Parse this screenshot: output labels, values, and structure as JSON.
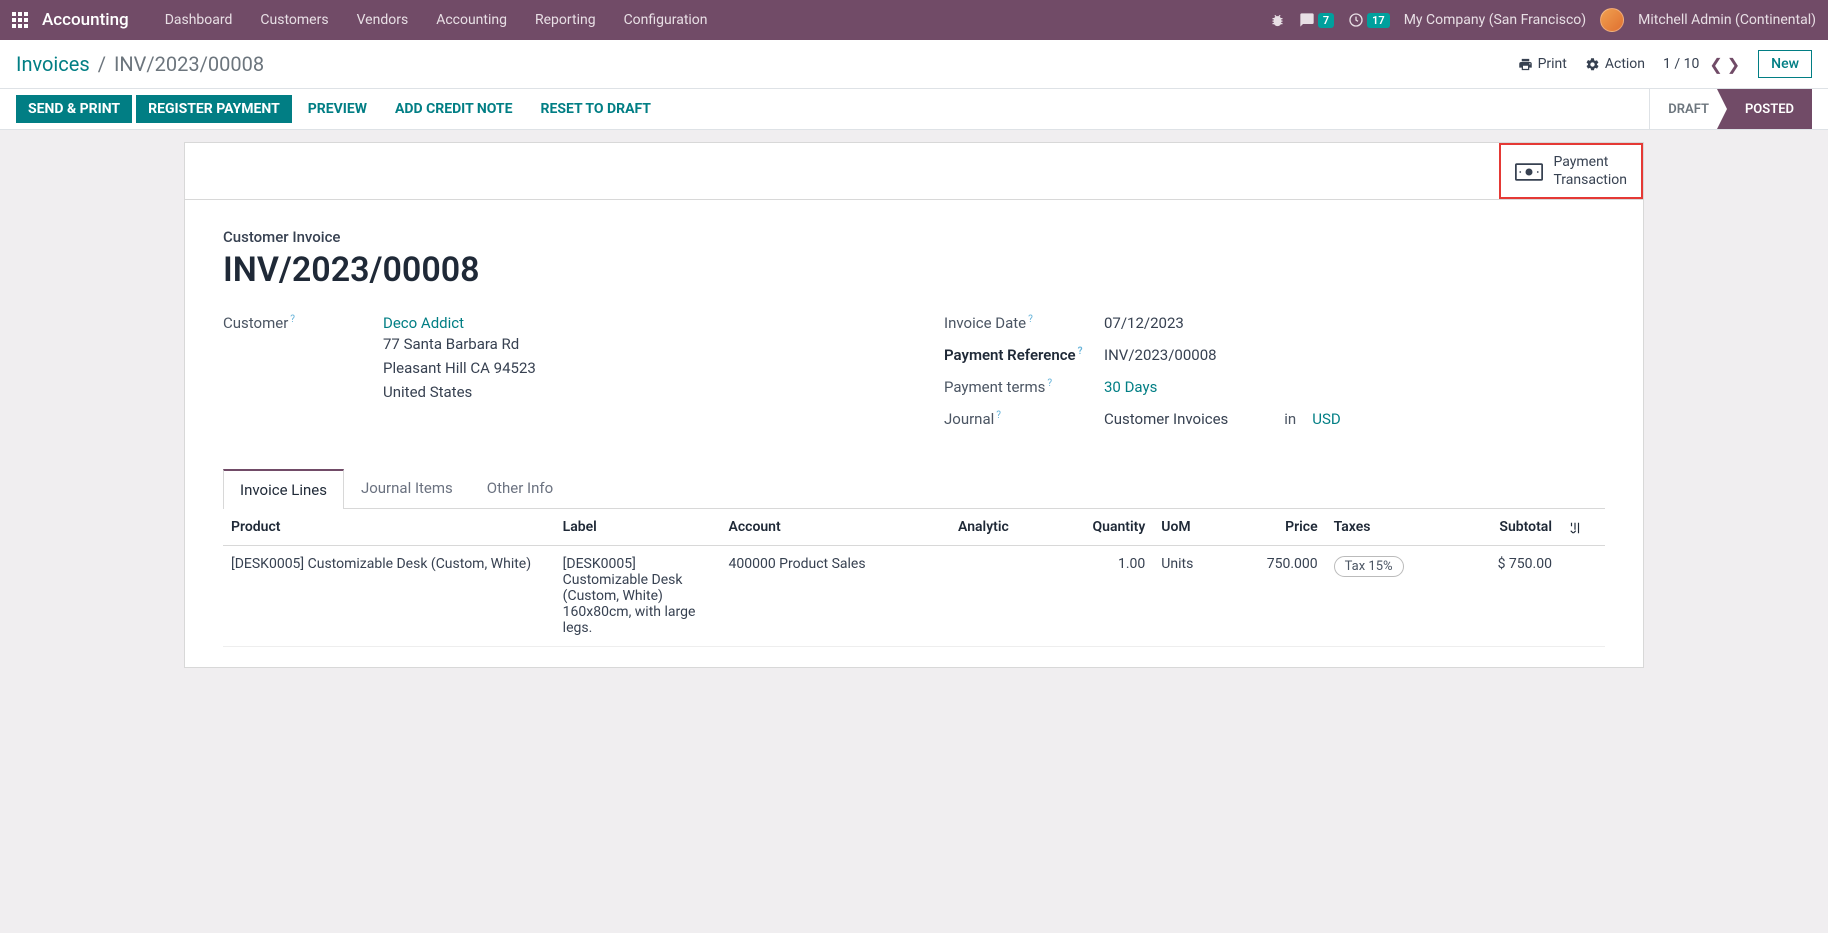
{
  "navbar": {
    "app": "Accounting",
    "menu": [
      "Dashboard",
      "Customers",
      "Vendors",
      "Accounting",
      "Reporting",
      "Configuration"
    ],
    "messages_badge": "7",
    "activities_badge": "17",
    "company": "My Company (San Francisco)",
    "user": "Mitchell Admin (Continental)"
  },
  "breadcrumb": {
    "parent": "Invoices",
    "current": "INV/2023/00008"
  },
  "cp": {
    "print": "Print",
    "action": "Action",
    "pager": "1 / 10",
    "new": "New"
  },
  "buttons": {
    "send_print": "SEND & PRINT",
    "register_payment": "REGISTER PAYMENT",
    "preview": "PREVIEW",
    "credit_note": "ADD CREDIT NOTE",
    "reset_draft": "RESET TO DRAFT"
  },
  "status": {
    "draft": "DRAFT",
    "posted": "POSTED"
  },
  "stat_button": {
    "line1": "Payment",
    "line2": "Transaction"
  },
  "form": {
    "type_label": "Customer Invoice",
    "name": "INV/2023/00008",
    "labels": {
      "customer": "Customer",
      "invoice_date": "Invoice Date",
      "payment_reference": "Payment Reference",
      "payment_terms": "Payment terms",
      "journal": "Journal",
      "in": "in"
    },
    "customer": {
      "name": "Deco Addict",
      "street": "77 Santa Barbara Rd",
      "city": "Pleasant Hill CA 94523",
      "country": "United States"
    },
    "invoice_date": "07/12/2023",
    "payment_reference": "INV/2023/00008",
    "payment_terms": "30 Days",
    "journal": "Customer Invoices",
    "currency": "USD"
  },
  "tabs": [
    "Invoice Lines",
    "Journal Items",
    "Other Info"
  ],
  "table": {
    "headers": {
      "product": "Product",
      "label": "Label",
      "account": "Account",
      "analytic": "Analytic",
      "quantity": "Quantity",
      "uom": "UoM",
      "price": "Price",
      "taxes": "Taxes",
      "subtotal": "Subtotal"
    },
    "rows": [
      {
        "product": "[DESK0005] Customizable Desk (Custom, White)",
        "label": "[DESK0005] Customizable Desk (Custom, White) 160x80cm, with large legs.",
        "account": "400000 Product Sales",
        "analytic": "",
        "quantity": "1.00",
        "uom": "Units",
        "price": "750.000",
        "taxes": "Tax 15%",
        "subtotal": "$ 750.00"
      }
    ]
  }
}
